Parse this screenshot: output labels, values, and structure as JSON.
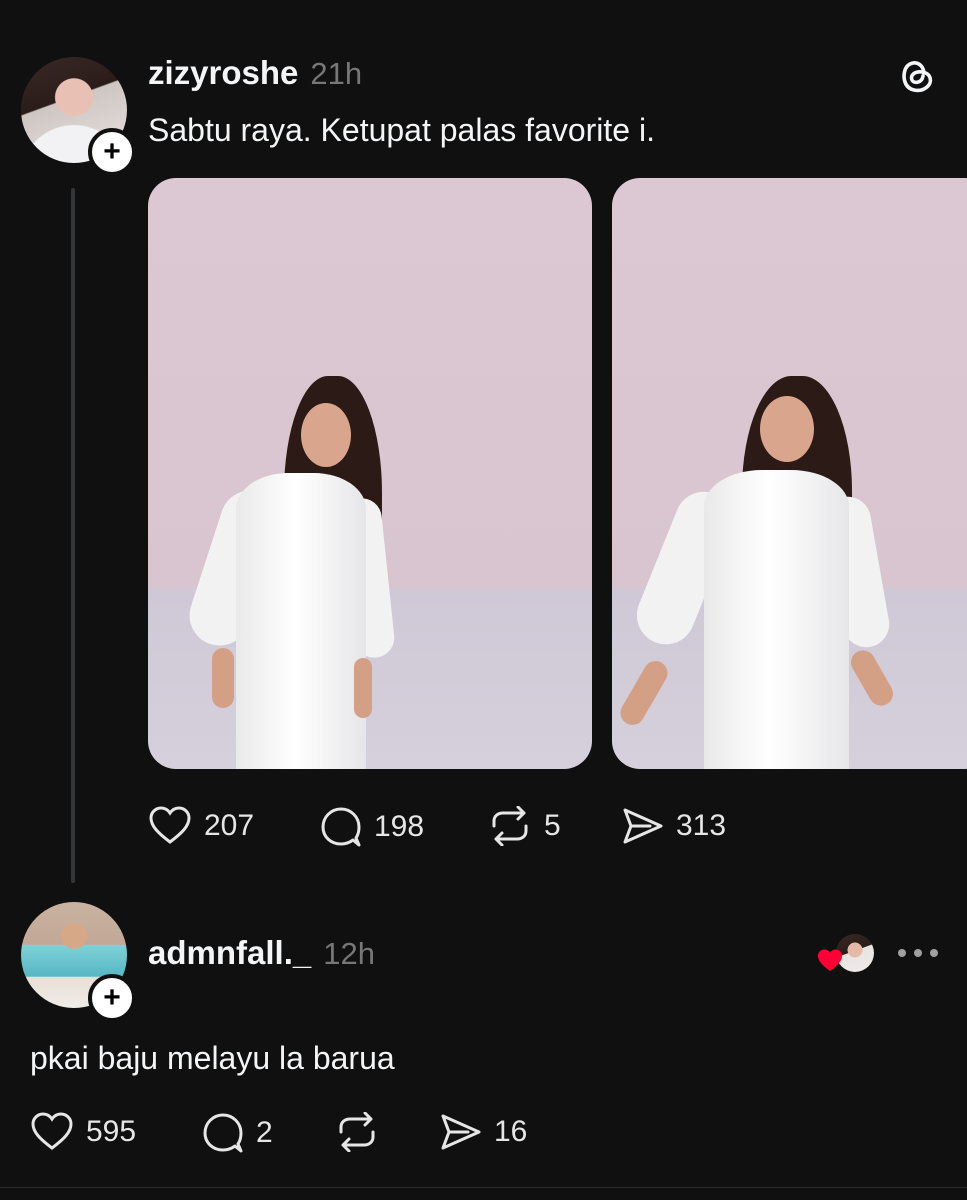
{
  "post": {
    "username": "zizyroshe",
    "time": "21h",
    "text": "Sabtu raya. Ketupat palas favorite i.",
    "likes": "207",
    "replies": "198",
    "reposts": "5",
    "shares": "313"
  },
  "reply": {
    "username": "admnfall._",
    "time": "12h",
    "text": "pkai baju melayu la barua",
    "likes": "595",
    "replies": "2",
    "shares": "16"
  },
  "icons": {
    "follow": "+",
    "app": "threads-logo-icon",
    "like": "heart-icon",
    "reply": "comment-icon",
    "repost": "repost-icon",
    "share": "send-icon",
    "more": "more-dots-icon",
    "liked_by_author": "heart-badge-icon"
  },
  "colors": {
    "background": "#101010",
    "text": "#f3f5f7",
    "muted": "#777777",
    "heart": "#ff0034"
  }
}
